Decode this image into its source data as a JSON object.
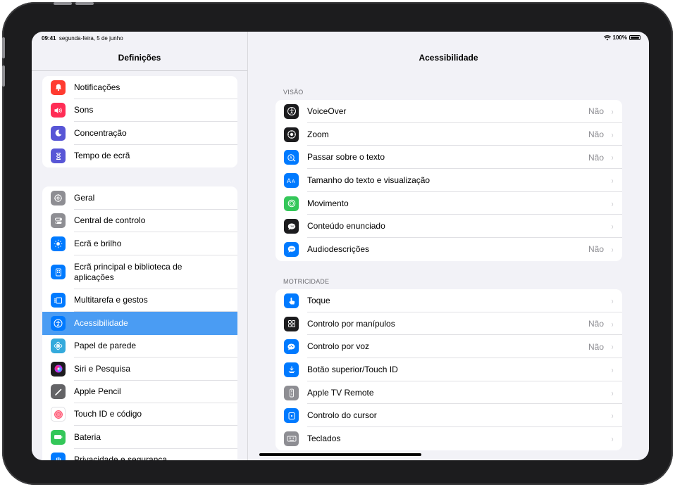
{
  "status": {
    "time": "09:41",
    "date": "segunda-feira, 5 de junho",
    "battery": "100%"
  },
  "sidebar": {
    "title": "Definições",
    "groups": [
      [
        {
          "label": "Notificações",
          "icon": "bell-icon",
          "color": "#ff3b30"
        },
        {
          "label": "Sons",
          "icon": "speaker-icon",
          "color": "#ff2d55"
        },
        {
          "label": "Concentração",
          "icon": "moon-icon",
          "color": "#5856d6"
        },
        {
          "label": "Tempo de ecrã",
          "icon": "hourglass-icon",
          "color": "#5856d6"
        }
      ],
      [
        {
          "label": "Geral",
          "icon": "gear-icon",
          "color": "#8e8e93"
        },
        {
          "label": "Central de controlo",
          "icon": "toggles-icon",
          "color": "#8e8e93"
        },
        {
          "label": "Ecrã e brilho",
          "icon": "sun-icon",
          "color": "#007aff"
        },
        {
          "label": "Ecrã principal e biblioteca de aplicações",
          "icon": "home-screen-icon",
          "color": "#007aff"
        },
        {
          "label": "Multitarefa e gestos",
          "icon": "multitask-icon",
          "color": "#007aff"
        },
        {
          "label": "Acessibilidade",
          "icon": "accessibility-icon",
          "color": "#007aff",
          "selected": true
        },
        {
          "label": "Papel de parede",
          "icon": "flower-icon",
          "color": "#34aadc"
        },
        {
          "label": "Siri e Pesquisa",
          "icon": "siri-icon",
          "color": "#1c1c1e"
        },
        {
          "label": "Apple Pencil",
          "icon": "pencil-icon",
          "color": "#636366"
        },
        {
          "label": "Touch ID e código",
          "icon": "fingerprint-icon",
          "color": "#ffffff"
        },
        {
          "label": "Bateria",
          "icon": "battery-icon",
          "color": "#34c759"
        },
        {
          "label": "Privacidade e segurança",
          "icon": "hand-icon",
          "color": "#007aff"
        }
      ]
    ]
  },
  "main": {
    "title": "Acessibilidade",
    "sections": [
      {
        "header": "VISÃO",
        "rows": [
          {
            "label": "VoiceOver",
            "value": "Não",
            "icon": "voiceover-icon",
            "color": "#1c1c1e"
          },
          {
            "label": "Zoom",
            "value": "Não",
            "icon": "zoom-icon",
            "color": "#1c1c1e"
          },
          {
            "label": "Passar sobre o texto",
            "value": "Não",
            "icon": "hover-text-icon",
            "color": "#007aff"
          },
          {
            "label": "Tamanho do texto e visualização",
            "value": "",
            "icon": "text-size-icon",
            "color": "#007aff"
          },
          {
            "label": "Movimento",
            "value": "",
            "icon": "motion-icon",
            "color": "#34c759"
          },
          {
            "label": "Conteúdo enunciado",
            "value": "",
            "icon": "spoken-content-icon",
            "color": "#1c1c1e"
          },
          {
            "label": "Audiodescrições",
            "value": "Não",
            "icon": "audio-description-icon",
            "color": "#007aff"
          }
        ]
      },
      {
        "header": "MOTRICIDADE",
        "rows": [
          {
            "label": "Toque",
            "value": "",
            "icon": "touch-icon",
            "color": "#007aff"
          },
          {
            "label": "Controlo por manípulos",
            "value": "Não",
            "icon": "switch-control-icon",
            "color": "#1c1c1e"
          },
          {
            "label": "Controlo por voz",
            "value": "Não",
            "icon": "voice-control-icon",
            "color": "#007aff"
          },
          {
            "label": "Botão superior/Touch ID",
            "value": "",
            "icon": "top-button-icon",
            "color": "#007aff"
          },
          {
            "label": "Apple TV Remote",
            "value": "",
            "icon": "remote-icon",
            "color": "#8e8e93"
          },
          {
            "label": "Controlo do cursor",
            "value": "",
            "icon": "cursor-icon",
            "color": "#007aff"
          },
          {
            "label": "Teclados",
            "value": "",
            "icon": "keyboard-icon",
            "color": "#8e8e93"
          }
        ]
      }
    ]
  }
}
